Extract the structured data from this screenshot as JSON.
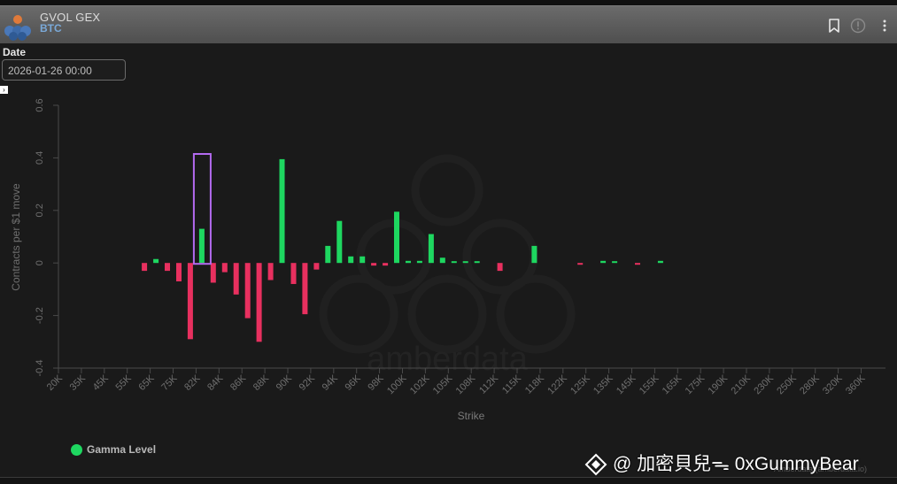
{
  "header": {
    "app_title": "GVOL GEX",
    "asset": "BTC",
    "icons": [
      "bookmark-icon",
      "info-icon",
      "more-vert-icon"
    ]
  },
  "filters": {
    "date_label": "Date",
    "date_value": "2026-01-26 00:00"
  },
  "colors": {
    "positive": "#1ed760",
    "negative": "#e8305f",
    "highlight": "#b36af0",
    "header_bg": "#5c5c5c"
  },
  "chart_data": {
    "type": "bar",
    "xlabel": "Strike",
    "ylabel": "Contracts per $1 move",
    "ylim": [
      -0.4,
      0.6
    ],
    "yticks": [
      "-0.4",
      "-0.2",
      "0",
      "0.2",
      "0.4",
      "0.6"
    ],
    "categories": [
      "20K",
      "35K",
      "45K",
      "55K",
      "65K",
      "75K",
      "82K",
      "84K",
      "86K",
      "88K",
      "90K",
      "92K",
      "94K",
      "96K",
      "98K",
      "100K",
      "102K",
      "105K",
      "108K",
      "112K",
      "115K",
      "118K",
      "122K",
      "125K",
      "135K",
      "145K",
      "155K",
      "165K",
      "175K",
      "190K",
      "210K",
      "230K",
      "250K",
      "280K",
      "320K",
      "360K"
    ],
    "series": [
      {
        "name": "Gamma Level",
        "values": [
          [
            0,
            0
          ],
          [
            0,
            0
          ],
          [
            0,
            0
          ],
          [
            0,
            0
          ],
          [
            -0.03,
            0.015
          ],
          [
            -0.03,
            -0.07
          ],
          [
            -0.29,
            0.13
          ],
          [
            -0.075,
            -0.035
          ],
          [
            -0.12,
            -0.21
          ],
          [
            -0.3,
            -0.065
          ],
          [
            0.395,
            -0.08
          ],
          [
            -0.195,
            -0.025
          ],
          [
            0.065,
            0.16
          ],
          [
            0.025,
            0.025
          ],
          [
            -0.01,
            -0.01
          ],
          [
            0.195,
            0.008
          ],
          [
            0.008,
            0.11
          ],
          [
            0.02,
            0.004
          ],
          [
            0.004,
            0.004
          ],
          [
            0,
            -0.03
          ],
          [
            0,
            0
          ],
          [
            0.065,
            0
          ],
          [
            0,
            0
          ],
          [
            -0.005,
            0
          ],
          [
            0.008,
            0.005
          ],
          [
            0,
            -0.006
          ],
          [
            0,
            0.008
          ],
          [
            0,
            0
          ],
          [
            0,
            0
          ],
          [
            0,
            0
          ],
          [
            0,
            0
          ],
          [
            0,
            0
          ],
          [
            0,
            0
          ],
          [
            0,
            0
          ],
          [
            0,
            0
          ],
          [
            0,
            0
          ]
        ]
      }
    ],
    "highlighted_category": "82K",
    "legend": [
      "Gamma Level"
    ],
    "legend_position": "bottom-left",
    "grid": false,
    "watermark": "amberdata"
  },
  "footer": {
    "credit": "Amberdata (amberdata.io)",
    "watermark_user": "@ 加密貝兒ᯓ 0xGummyBear"
  }
}
